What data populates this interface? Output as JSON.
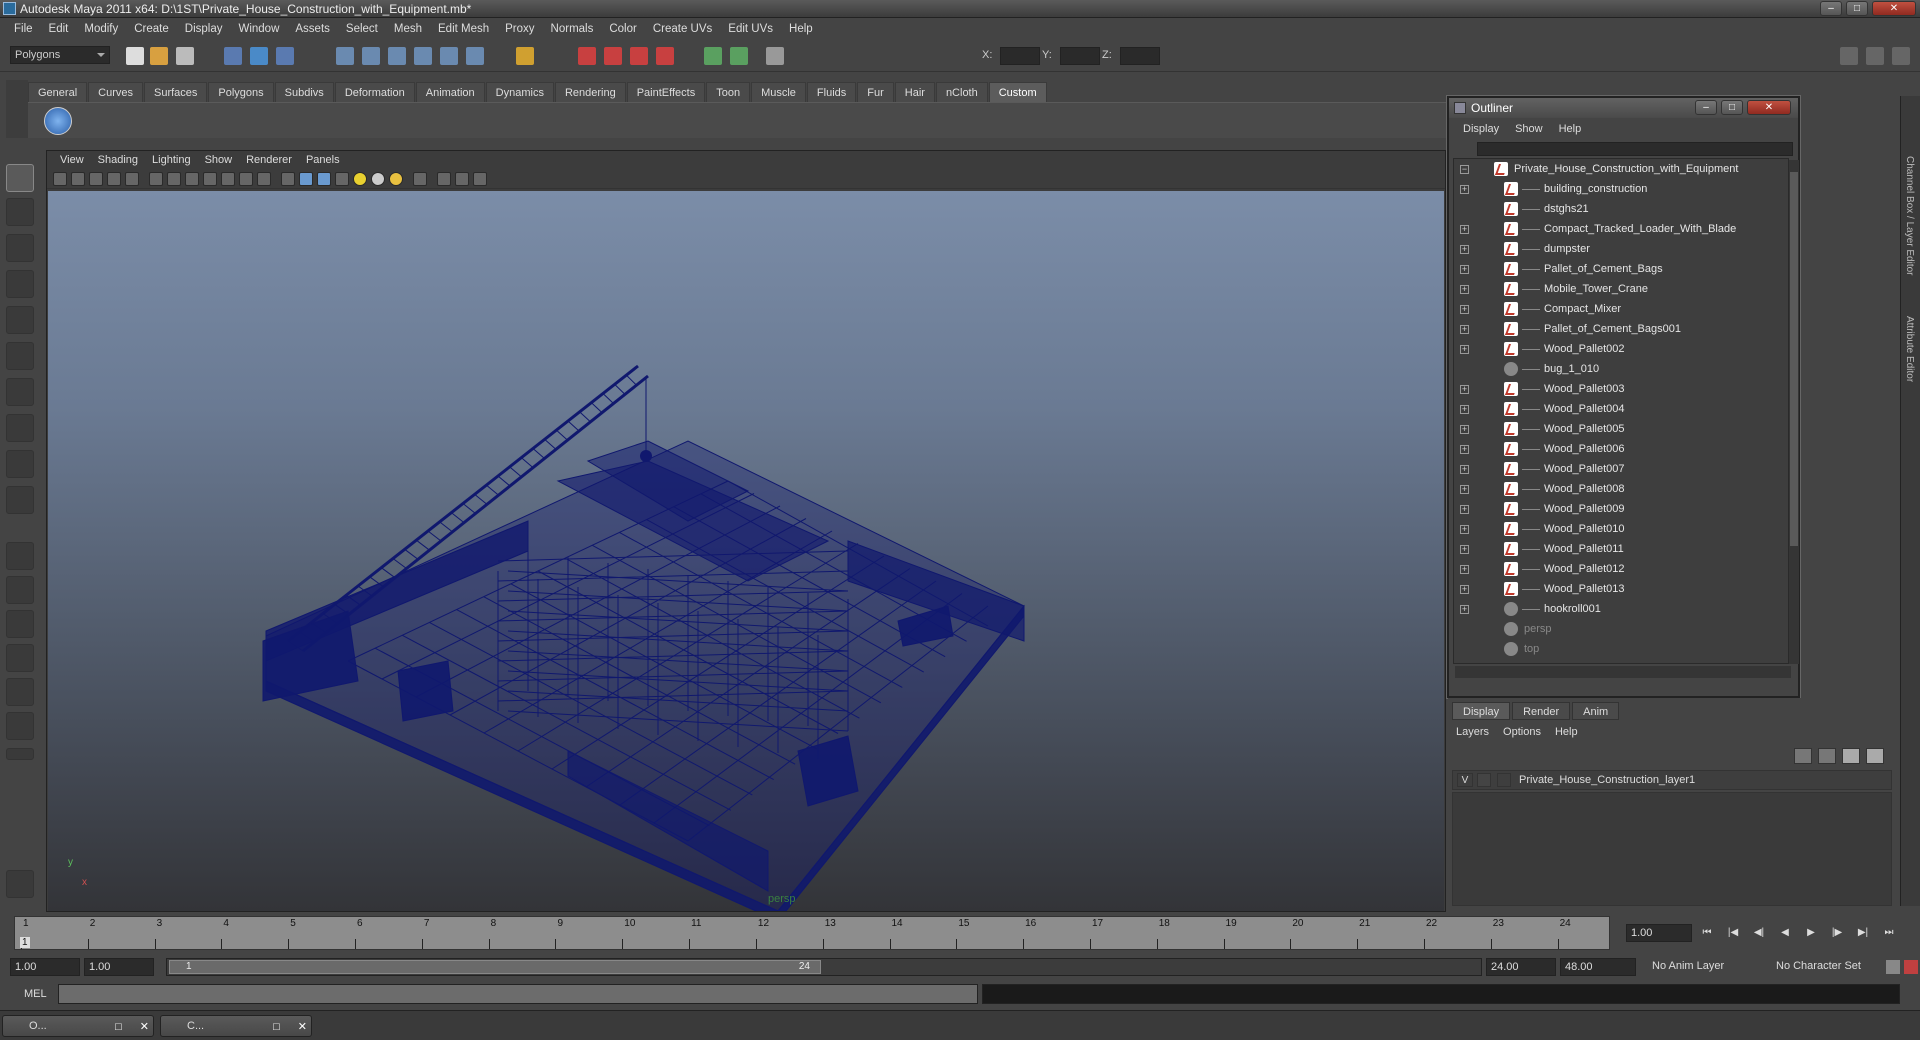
{
  "window": {
    "title": "Autodesk Maya 2011 x64: D:\\1ST\\Private_House_Construction_with_Equipment.mb*"
  },
  "menubar": [
    "File",
    "Edit",
    "Modify",
    "Create",
    "Display",
    "Window",
    "Assets",
    "Select",
    "Mesh",
    "Edit Mesh",
    "Proxy",
    "Normals",
    "Color",
    "Create UVs",
    "Edit UVs",
    "Help"
  ],
  "statusline": {
    "mode": "Polygons",
    "x_label": "X:",
    "y_label": "Y:",
    "z_label": "Z:"
  },
  "shelf": {
    "tabs": [
      "General",
      "Curves",
      "Surfaces",
      "Polygons",
      "Subdivs",
      "Deformation",
      "Animation",
      "Dynamics",
      "Rendering",
      "PaintEffects",
      "Toon",
      "Muscle",
      "Fluids",
      "Fur",
      "Hair",
      "nCloth",
      "Custom"
    ],
    "active": "Custom"
  },
  "viewport": {
    "menu": [
      "View",
      "Shading",
      "Lighting",
      "Show",
      "Renderer",
      "Panels"
    ],
    "camera": "persp",
    "axis_y": "y",
    "axis_x": "x",
    "wire_color": "#10186e"
  },
  "outliner": {
    "title": "Outliner",
    "menu": [
      "Display",
      "Show",
      "Help"
    ],
    "root": "Private_House_Construction_with_Equipment",
    "items": [
      {
        "label": "building_construction",
        "icon": "mesh-icon",
        "expandable": true
      },
      {
        "label": "dstghs21",
        "icon": "mesh-icon",
        "expandable": false
      },
      {
        "label": "Compact_Tracked_Loader_With_Blade",
        "icon": "mesh-icon",
        "expandable": true
      },
      {
        "label": "dumpster",
        "icon": "mesh-icon",
        "expandable": true
      },
      {
        "label": "Pallet_of_Cement_Bags",
        "icon": "mesh-icon",
        "expandable": true
      },
      {
        "label": "Mobile_Tower_Crane",
        "icon": "mesh-icon",
        "expandable": true
      },
      {
        "label": "Compact_Mixer",
        "icon": "mesh-icon",
        "expandable": true
      },
      {
        "label": "Pallet_of_Cement_Bags001",
        "icon": "mesh-icon",
        "expandable": true
      },
      {
        "label": "Wood_Pallet002",
        "icon": "mesh-icon",
        "expandable": true
      },
      {
        "label": "bug_1_010",
        "icon": "group-icon",
        "expandable": false
      },
      {
        "label": "Wood_Pallet003",
        "icon": "mesh-icon",
        "expandable": true
      },
      {
        "label": "Wood_Pallet004",
        "icon": "mesh-icon",
        "expandable": true
      },
      {
        "label": "Wood_Pallet005",
        "icon": "mesh-icon",
        "expandable": true
      },
      {
        "label": "Wood_Pallet006",
        "icon": "mesh-icon",
        "expandable": true
      },
      {
        "label": "Wood_Pallet007",
        "icon": "mesh-icon",
        "expandable": true
      },
      {
        "label": "Wood_Pallet008",
        "icon": "mesh-icon",
        "expandable": true
      },
      {
        "label": "Wood_Pallet009",
        "icon": "mesh-icon",
        "expandable": true
      },
      {
        "label": "Wood_Pallet010",
        "icon": "mesh-icon",
        "expandable": true
      },
      {
        "label": "Wood_Pallet011",
        "icon": "mesh-icon",
        "expandable": true
      },
      {
        "label": "Wood_Pallet012",
        "icon": "mesh-icon",
        "expandable": true
      },
      {
        "label": "Wood_Pallet013",
        "icon": "mesh-icon",
        "expandable": true
      },
      {
        "label": "hookroll001",
        "icon": "group-icon",
        "expandable": true
      }
    ],
    "cameras": [
      "persp",
      "top"
    ]
  },
  "layer_editor": {
    "tabs": [
      "Display",
      "Render",
      "Anim"
    ],
    "active_tab": "Display",
    "menu": [
      "Layers",
      "Options",
      "Help"
    ],
    "layer": {
      "visible": "V",
      "name": "Private_House_Construction_layer1"
    }
  },
  "side_tabs": [
    "Channel Box / Layer Editor",
    "Attribute Editor"
  ],
  "timeline": {
    "ticks": [
      "1",
      "2",
      "3",
      "4",
      "5",
      "6",
      "7",
      "8",
      "9",
      "10",
      "11",
      "12",
      "13",
      "14",
      "15",
      "16",
      "17",
      "18",
      "19",
      "20",
      "21",
      "22",
      "23",
      "24"
    ],
    "current_marker": "1",
    "current_frame": "1.00"
  },
  "range": {
    "start": "1.00",
    "playback_start": "1.00",
    "slider_start": "1",
    "slider_end": "24",
    "playback_end": "24.00",
    "end": "48.00",
    "anim_layer": "No Anim Layer",
    "char_set": "No Character Set"
  },
  "cmdline": {
    "label": "MEL"
  },
  "taskbar": [
    {
      "label": "O..."
    },
    {
      "label": "C..."
    }
  ]
}
